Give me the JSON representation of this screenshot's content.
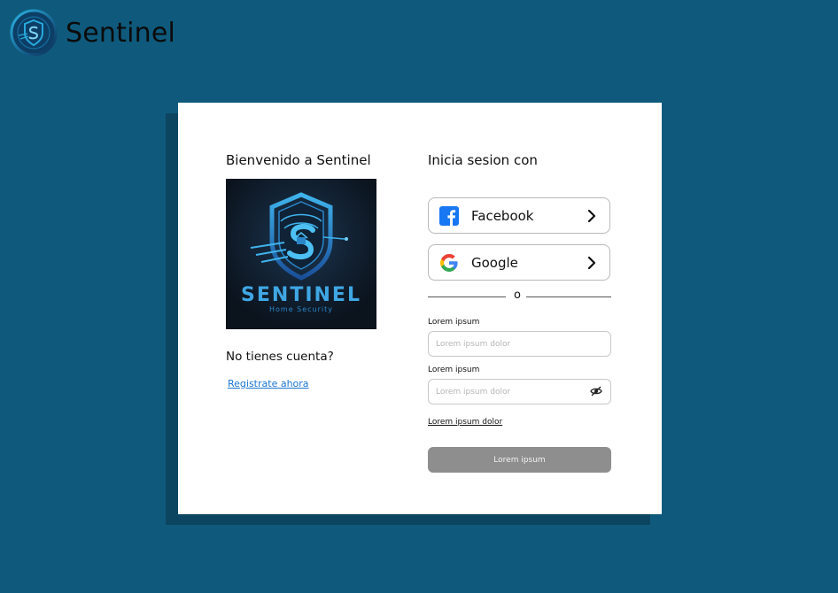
{
  "brand": {
    "name": "Sentinel",
    "logo_icon": "shield-logo-icon"
  },
  "left": {
    "title": "Bienvenido a Sentinel",
    "hero_image": {
      "title_text": "SENTINEL",
      "subtitle_text": "Home Security"
    },
    "no_account": "No tienes cuenta?",
    "register_link": "Registrate ahora"
  },
  "right": {
    "title": "Inicia sesion con",
    "facebook_label": "Facebook",
    "google_label": "Google",
    "divider_text": "o",
    "field1_label": "Lorem ipsum",
    "field1_placeholder": "Lorem ipsum dolor",
    "field2_label": "Lorem ipsum",
    "field2_placeholder": "Lorem ipsum dolor",
    "forgot_link": "Lorem ipsum dolor",
    "submit_label": "Lorem ipsum"
  },
  "colors": {
    "background": "#0f5a7c",
    "card": "#ffffff",
    "link": "#1a75d2",
    "button_disabled": "#8f8e8e",
    "facebook_blue": "#1877f2"
  }
}
